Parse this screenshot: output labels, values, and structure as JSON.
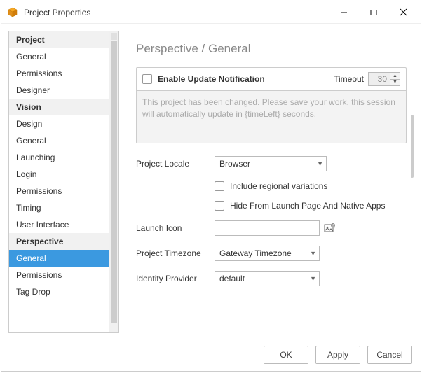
{
  "window": {
    "title": "Project Properties"
  },
  "sidebar": {
    "items": [
      {
        "label": "Project",
        "header": true
      },
      {
        "label": "General"
      },
      {
        "label": "Permissions"
      },
      {
        "label": "Designer"
      },
      {
        "label": "Vision",
        "header": true
      },
      {
        "label": "Design"
      },
      {
        "label": "General"
      },
      {
        "label": "Launching"
      },
      {
        "label": "Login"
      },
      {
        "label": "Permissions"
      },
      {
        "label": "Timing"
      },
      {
        "label": "User Interface"
      },
      {
        "label": "Perspective",
        "header": true
      },
      {
        "label": "General",
        "selected": true
      },
      {
        "label": "Permissions"
      },
      {
        "label": "Tag Drop"
      }
    ]
  },
  "main": {
    "heading": "Perspective / General",
    "enable_label": "Enable Update Notification",
    "timeout_label": "Timeout",
    "timeout_value": "30",
    "message": "This project has been changed. Please save your work, this session will automatically update in {timeLeft} seconds.",
    "locale_label": "Project Locale",
    "locale_value": "Browser",
    "include_regional_label": "Include regional variations",
    "hide_from_label": "Hide From Launch Page And Native Apps",
    "launch_icon_label": "Launch Icon",
    "launch_icon_value": "",
    "timezone_label": "Project Timezone",
    "timezone_value": "Gateway Timezone",
    "idp_label": "Identity Provider",
    "idp_value": "default"
  },
  "footer": {
    "ok": "OK",
    "apply": "Apply",
    "cancel": "Cancel"
  }
}
